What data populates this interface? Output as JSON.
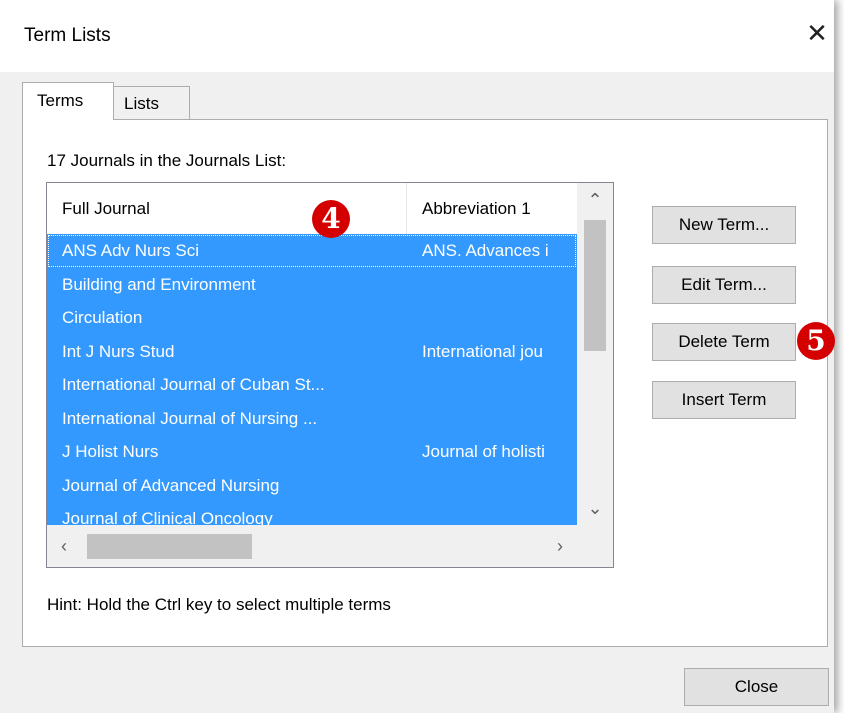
{
  "window": {
    "title": "Term Lists"
  },
  "tabs": [
    {
      "label": "Terms"
    },
    {
      "label": "Lists"
    }
  ],
  "list": {
    "caption": "17 Journals in the Journals List:",
    "columns": [
      "Full Journal",
      "Abbreviation 1"
    ],
    "rows": [
      {
        "full": "ANS Adv Nurs Sci",
        "abbr": "ANS. Advances i"
      },
      {
        "full": "Building and Environment",
        "abbr": ""
      },
      {
        "full": "Circulation",
        "abbr": ""
      },
      {
        "full": "Int J Nurs Stud",
        "abbr": "International jou"
      },
      {
        "full": "International Journal of Cuban St...",
        "abbr": ""
      },
      {
        "full": "International Journal of Nursing ...",
        "abbr": ""
      },
      {
        "full": "J Holist Nurs",
        "abbr": "Journal of holisti"
      },
      {
        "full": "Journal of Advanced Nursing",
        "abbr": ""
      },
      {
        "full": "Journal of Clinical Oncology",
        "abbr": ""
      }
    ],
    "hint": "Hint: Hold the Ctrl key to select multiple terms"
  },
  "buttons": {
    "new_term": "New Term...",
    "edit_term": "Edit Term...",
    "delete_term": "Delete Term",
    "insert_term": "Insert Term",
    "close": "Close"
  },
  "annotations": {
    "badge_4": "4",
    "badge_5": "5"
  },
  "icons": {
    "close": "close-icon",
    "scroll_up": "chevron-up-icon",
    "scroll_down": "chevron-down-icon",
    "scroll_left": "chevron-left-icon",
    "scroll_right": "chevron-right-icon"
  },
  "colors": {
    "selection": "#3399ff",
    "badge": "#d40000"
  }
}
